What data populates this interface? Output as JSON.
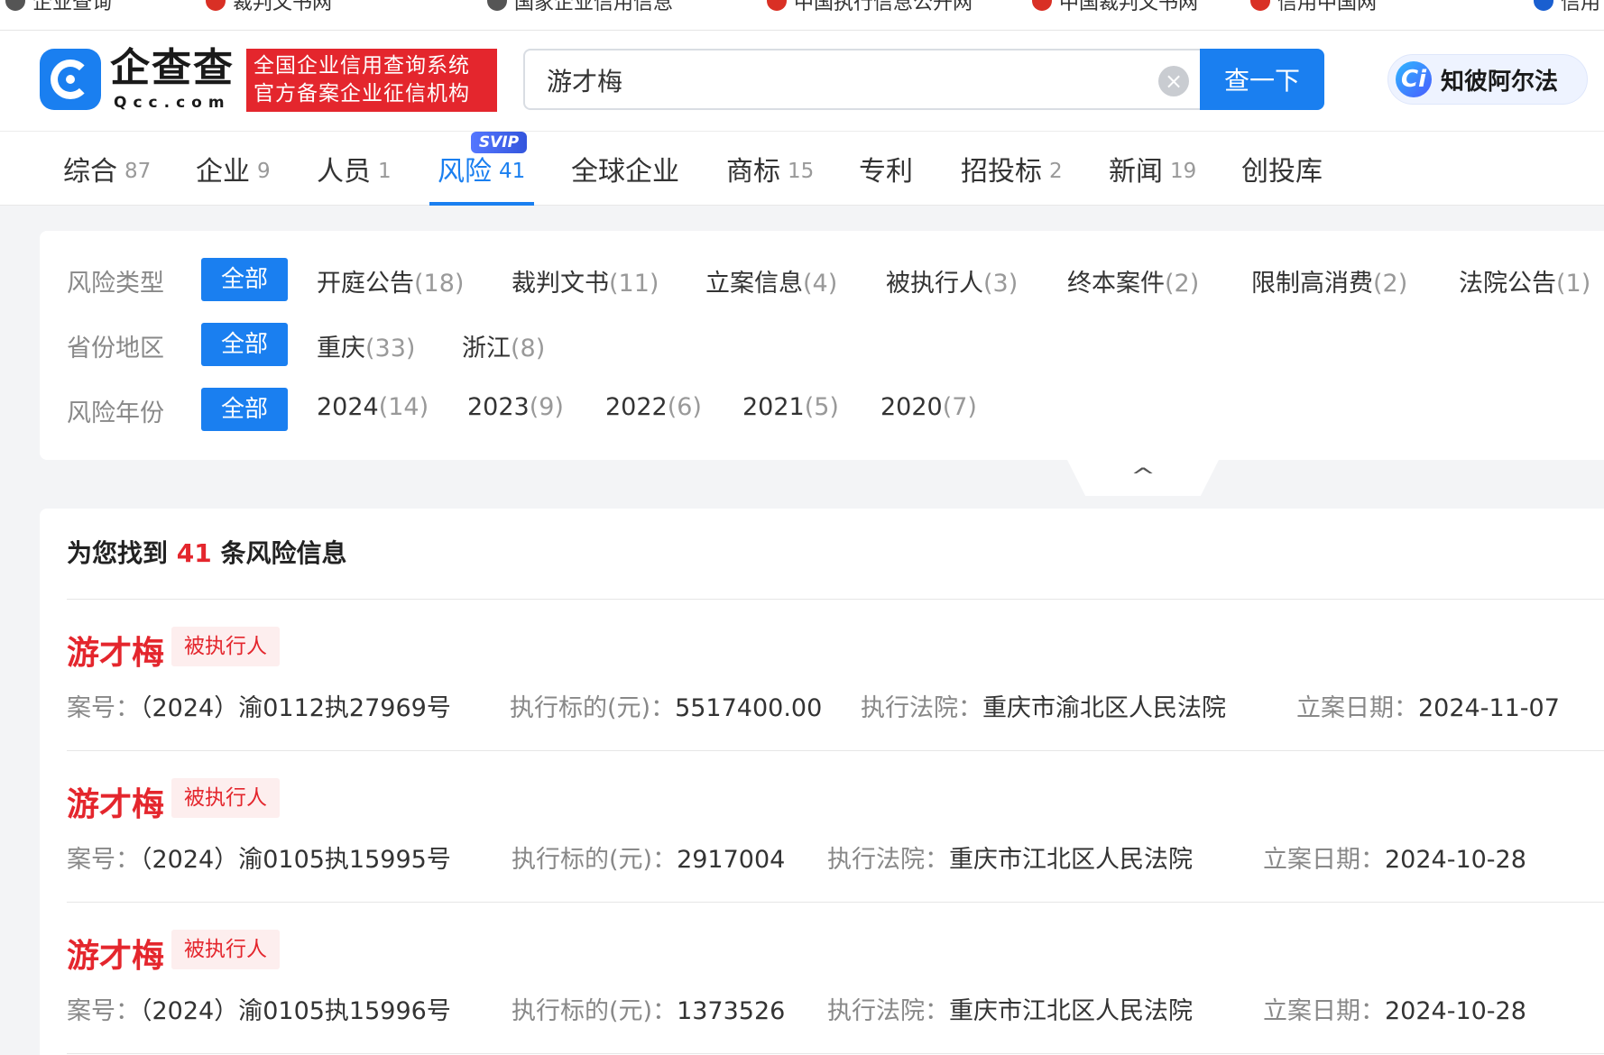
{
  "bookmarks": [
    {
      "label": "企业查询",
      "color": "#555555"
    },
    {
      "label": "裁判文书网",
      "color": "#d93025"
    },
    {
      "label": "国家企业信用信息",
      "color": "#555555"
    },
    {
      "label": "中国执行信息公开网",
      "color": "#d93025"
    },
    {
      "label": "中国裁判文书网",
      "color": "#d93025"
    },
    {
      "label": "信用中国网",
      "color": "#d93025"
    },
    {
      "label": "信用",
      "color": "#1a5fd0"
    }
  ],
  "header": {
    "logo_name": "企查查",
    "logo_domain": "Qcc.com",
    "slogan_line1": "全国企业信用查询系统",
    "slogan_line2": "官方备案企业征信机构",
    "search_value": "游才梅",
    "search_button": "查一下",
    "ai_logo_text": "Ci",
    "ai_label": "知彼阿尔法",
    "clear_icon": "×"
  },
  "tabs": [
    {
      "label": "综合",
      "count": "87"
    },
    {
      "label": "企业",
      "count": "9"
    },
    {
      "label": "人员",
      "count": "1"
    },
    {
      "label": "风险",
      "count": "41",
      "active": true,
      "badge": "SVIP"
    },
    {
      "label": "全球企业",
      "count": ""
    },
    {
      "label": "商标",
      "count": "15"
    },
    {
      "label": "专利",
      "count": ""
    },
    {
      "label": "招投标",
      "count": "2"
    },
    {
      "label": "新闻",
      "count": "19"
    },
    {
      "label": "创投库",
      "count": ""
    }
  ],
  "filters": {
    "all_label": "全部",
    "risk_type": {
      "label": "风险类型",
      "items": [
        {
          "name": "开庭公告",
          "count": "(18)"
        },
        {
          "name": "裁判文书",
          "count": "(11)"
        },
        {
          "name": "立案信息",
          "count": "(4)"
        },
        {
          "name": "被执行人",
          "count": "(3)"
        },
        {
          "name": "终本案件",
          "count": "(2)"
        },
        {
          "name": "限制高消费",
          "count": "(2)"
        },
        {
          "name": "法院公告",
          "count": "(1)"
        }
      ]
    },
    "province": {
      "label": "省份地区",
      "items": [
        {
          "name": "重庆",
          "count": "(33)"
        },
        {
          "name": "浙江",
          "count": "(8)"
        }
      ]
    },
    "year": {
      "label": "风险年份",
      "items": [
        {
          "name": "2024",
          "count": "(14)"
        },
        {
          "name": "2023",
          "count": "(9)"
        },
        {
          "name": "2022",
          "count": "(6)"
        },
        {
          "name": "2021",
          "count": "(5)"
        },
        {
          "name": "2020",
          "count": "(7)"
        }
      ]
    },
    "collapse_icon": "^"
  },
  "results": {
    "title_prefix": "为您找到",
    "count": "41",
    "title_suffix": "条风险信息",
    "items": [
      {
        "name": "游才梅",
        "tag": "被执行人",
        "case_label": "案号：",
        "case_no": "（2024）渝0112执27969号",
        "amount_label": "执行标的(元)：",
        "amount": "5517400.00",
        "court_label": "执行法院：",
        "court": "重庆市渝北区人民法院",
        "date_label": "立案日期：",
        "date": "2024-11-07"
      },
      {
        "name": "游才梅",
        "tag": "被执行人",
        "case_label": "案号：",
        "case_no": "（2024）渝0105执15995号",
        "amount_label": "执行标的(元)：",
        "amount": "2917004",
        "court_label": "执行法院：",
        "court": "重庆市江北区人民法院",
        "date_label": "立案日期：",
        "date": "2024-10-28"
      },
      {
        "name": "游才梅",
        "tag": "被执行人",
        "case_label": "案号：",
        "case_no": "（2024）渝0105执15996号",
        "amount_label": "执行标的(元)：",
        "amount": "1373526",
        "court_label": "执行法院：",
        "court": "重庆市江北区人民法院",
        "date_label": "立案日期：",
        "date": "2024-10-28"
      }
    ]
  },
  "colors": {
    "brand_blue": "#1a7ff0",
    "risk_red": "#e4262d"
  }
}
